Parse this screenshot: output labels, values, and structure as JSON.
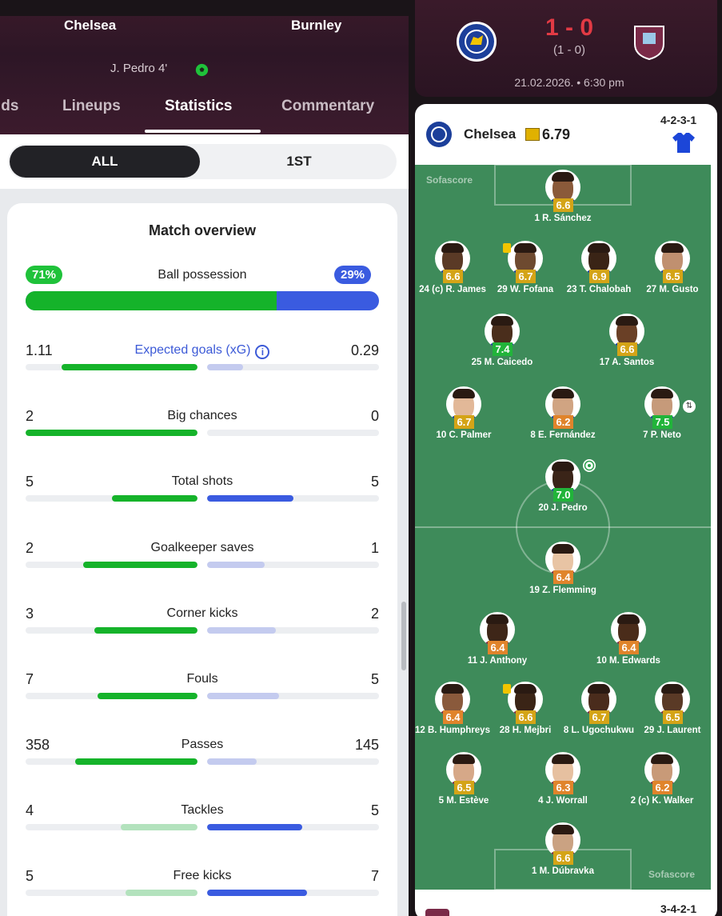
{
  "header": {
    "home_team": "Chelsea",
    "away_team": "Burnley",
    "scorer_line": "J. Pedro 4'",
    "tabs": [
      {
        "label": "lds",
        "active": false
      },
      {
        "label": "Lineups",
        "active": false
      },
      {
        "label": "Statistics",
        "active": true
      },
      {
        "label": "Commentary",
        "active": false
      }
    ]
  },
  "period": {
    "all": "ALL",
    "first": "1ST",
    "selected": "ALL"
  },
  "overview": {
    "title": "Match overview",
    "possession": {
      "label": "Ball possession",
      "home": "71%",
      "away": "29%",
      "home_pct": 71
    },
    "stats": [
      {
        "label": "Expected goals (xG)",
        "home": "1.11",
        "away": "0.29",
        "h": 1.11,
        "a": 0.29,
        "link": true
      },
      {
        "label": "Big chances",
        "home": "2",
        "away": "0",
        "h": 2,
        "a": 0
      },
      {
        "label": "Total shots",
        "home": "5",
        "away": "5",
        "h": 5,
        "a": 5
      },
      {
        "label": "Goalkeeper saves",
        "home": "2",
        "away": "1",
        "h": 2,
        "a": 1
      },
      {
        "label": "Corner kicks",
        "home": "3",
        "away": "2",
        "h": 3,
        "a": 2
      },
      {
        "label": "Fouls",
        "home": "7",
        "away": "5",
        "h": 7,
        "a": 5
      },
      {
        "label": "Passes",
        "home": "358",
        "away": "145",
        "h": 358,
        "a": 145
      },
      {
        "label": "Tackles",
        "home": "4",
        "away": "5",
        "h": 4,
        "a": 5
      },
      {
        "label": "Free kicks",
        "home": "5",
        "away": "7",
        "h": 5,
        "a": 7
      }
    ],
    "info_icon": "info-icon"
  },
  "score": {
    "main": "1 - 0",
    "halftime": "(1 - 0)",
    "date": "21.02.2026. • 6:30 pm"
  },
  "lineup": {
    "team": "Chelsea",
    "team_rating": "6.79",
    "formation_home": "4-2-3-1",
    "formation_away": "3-4-2-1",
    "watermark": "Sofascore",
    "players": [
      {
        "name": "1 R. Sánchez",
        "rating": "6.6",
        "tone": "yellow"
      },
      {
        "name": "24 (c) R. James",
        "rating": "6.6",
        "tone": "yellow"
      },
      {
        "name": "29 W. Fofana",
        "rating": "6.7",
        "tone": "yellow",
        "card": true
      },
      {
        "name": "23 T. Chalobah",
        "rating": "6.9",
        "tone": "yellow"
      },
      {
        "name": "27 M. Gusto",
        "rating": "6.5",
        "tone": "yellow"
      },
      {
        "name": "25 M. Caicedo",
        "rating": "7.4",
        "tone": "green"
      },
      {
        "name": "17 A. Santos",
        "rating": "6.6",
        "tone": "yellow"
      },
      {
        "name": "10 C. Palmer",
        "rating": "6.7",
        "tone": "yellow"
      },
      {
        "name": "8 E. Fernández",
        "rating": "6.2",
        "tone": "orange"
      },
      {
        "name": "7 P. Neto",
        "rating": "7.5",
        "tone": "green",
        "sub": true
      },
      {
        "name": "20 J. Pedro",
        "rating": "7.0",
        "tone": "green",
        "goal": true
      },
      {
        "name": "19 Z. Flemming",
        "rating": "6.4",
        "tone": "orange"
      },
      {
        "name": "11 J. Anthony",
        "rating": "6.4",
        "tone": "orange"
      },
      {
        "name": "10 M. Edwards",
        "rating": "6.4",
        "tone": "orange"
      },
      {
        "name": "12 B. Humphreys",
        "rating": "6.4",
        "tone": "orange"
      },
      {
        "name": "28 H. Mejbri",
        "rating": "6.6",
        "tone": "yellow",
        "card": true
      },
      {
        "name": "8 L. Ugochukwu",
        "rating": "6.7",
        "tone": "yellow"
      },
      {
        "name": "29 J. Laurent",
        "rating": "6.5",
        "tone": "yellow"
      },
      {
        "name": "5 M. Estève",
        "rating": "6.5",
        "tone": "yellow"
      },
      {
        "name": "4 J. Worrall",
        "rating": "6.3",
        "tone": "orange"
      },
      {
        "name": "2 (c) K. Walker",
        "rating": "6.2",
        "tone": "orange"
      },
      {
        "name": "1 M. Dúbravka",
        "rating": "6.6",
        "tone": "yellow"
      }
    ]
  },
  "colors": {
    "home": "#15b32a",
    "away": "#3a5be0",
    "score": "#e23a44",
    "pitch": "#3e8b5a"
  }
}
